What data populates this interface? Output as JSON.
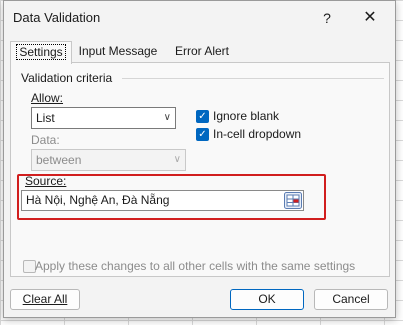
{
  "dialog": {
    "title": "Data Validation",
    "help_label": "?",
    "close_label": "✕"
  },
  "tabs": [
    {
      "label": "Settings",
      "active": true
    },
    {
      "label": "Input Message",
      "active": false
    },
    {
      "label": "Error Alert",
      "active": false
    }
  ],
  "settings": {
    "group_title": "Validation criteria",
    "allow_label": "Allow:",
    "allow_value": "List",
    "data_label": "Data:",
    "data_value": "between",
    "ignore_blank_label": "Ignore blank",
    "ignore_blank_checked": true,
    "in_cell_dropdown_label": "In-cell dropdown",
    "in_cell_dropdown_checked": true,
    "source_label": "Source:",
    "source_value": "Hà Nội, Nghệ An, Đà Nẵng",
    "apply_all_label": "Apply these changes to all other cells with the same settings",
    "apply_all_checked": false
  },
  "buttons": {
    "clear_all": "Clear All",
    "ok": "OK",
    "cancel": "Cancel"
  },
  "colors": {
    "accent": "#0067c0",
    "highlight": "#d11e1e"
  }
}
